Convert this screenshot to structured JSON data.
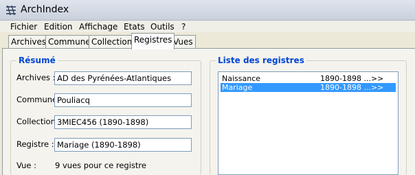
{
  "window": {
    "title": "ArchIndex"
  },
  "menu": [
    "Fichier",
    "Edition",
    "Affichage",
    "Etats",
    "Outils",
    "?"
  ],
  "tabs": [
    "Archives",
    "Communes",
    "Collections",
    "Registres",
    "Vues"
  ],
  "active_tab": "Registres",
  "resume": {
    "title": "Résumé",
    "archives_label": "Archives :",
    "archives_value": "AD des Pyrénées-Atlantiques",
    "commune_label": "Commune",
    "commune_value": "Pouliacq",
    "collection_label": "Collection",
    "collection_value": "3MIEC456 (1890-1898)",
    "registre_label": "Registre :",
    "registre_value": "Mariage (1890-1898)",
    "vue_label": "Vue :",
    "vue_value": "9 vues pour ce registre"
  },
  "liste": {
    "title": "Liste des registres",
    "items": [
      {
        "name": "Naissance",
        "years": "1890-1898 ...>>",
        "selected": false
      },
      {
        "name": "Mariage",
        "years": "1890-1898 ...>>",
        "selected": true
      }
    ]
  }
}
